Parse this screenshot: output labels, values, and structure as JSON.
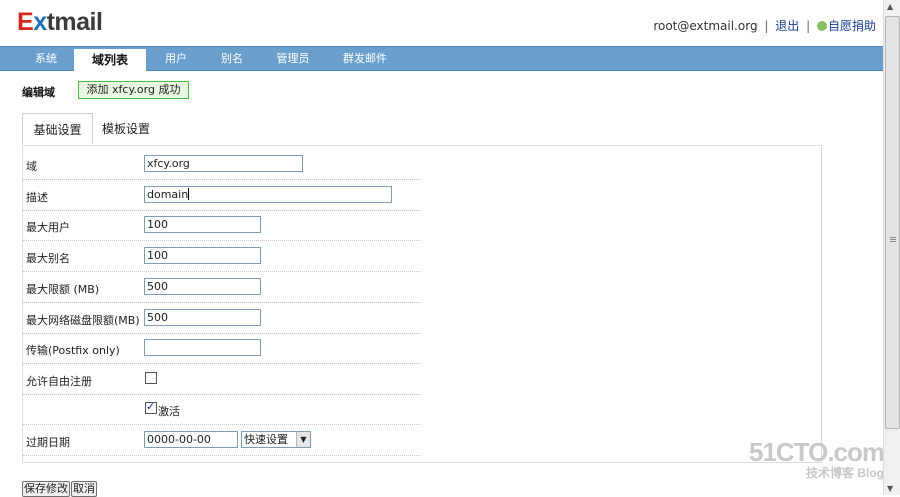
{
  "header": {
    "logo_prefix": "E",
    "logo_x": "x",
    "logo_rest": "tmail",
    "user": "root@extmail.org",
    "logout_label": "退出",
    "donate_label": "自愿捐助"
  },
  "nav": {
    "tabs": [
      {
        "label": "系统"
      },
      {
        "label": "域列表"
      },
      {
        "label": "用户"
      },
      {
        "label": "别名"
      },
      {
        "label": "管理员"
      },
      {
        "label": "群发邮件"
      }
    ]
  },
  "edit": {
    "heading": "编辑域",
    "success_message": "添加 xfcy.org 成功"
  },
  "subtabs": {
    "basic": "基础设置",
    "template": "模板设置"
  },
  "form": {
    "domain_label": "域",
    "domain_value": "xfcy.org",
    "desc_label": "描述",
    "desc_value": "domain",
    "max_users_label": "最大用户",
    "max_users_value": "100",
    "max_alias_label": "最大别名",
    "max_alias_value": "100",
    "quota_label": "最大限额 (MB)",
    "quota_value": "500",
    "netdisk_label": "最大网络磁盘限额(MB)",
    "netdisk_value": "500",
    "transport_label": "传输(Postfix only)",
    "transport_value": "",
    "allow_signup_label": "允许自由注册",
    "activate_label": "激活",
    "expire_label": "过期日期",
    "expire_value": "0000-00-00",
    "quick_set_label": "快速设置"
  },
  "actions": {
    "save_label": "保存修改",
    "cancel_label": "取消"
  },
  "watermark": {
    "line1": "51CTO.com",
    "line2": "技术博客 Blog"
  }
}
